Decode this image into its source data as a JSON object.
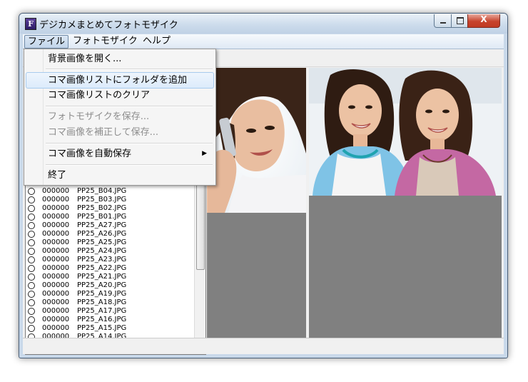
{
  "window": {
    "title": "デジカメまとめてフォトモザイク",
    "app_icon_letter": "F",
    "caption_buttons": {
      "min": "minimize",
      "max": "maximize",
      "close_glyph": "X"
    }
  },
  "menubar": [
    "ファイル",
    "フォトモザイク",
    "ヘルプ"
  ],
  "file_menu": {
    "open_background": "背景画像を開く...",
    "add_folder": "コマ画像リストにフォルダを追加",
    "clear_list": "コマ画像リストのクリア",
    "save_mosaic": "フォトモザイクを保存...",
    "correct_and_save": "コマ画像を補正して保存...",
    "auto_save": "コマ画像を自動保存",
    "exit": "終了"
  },
  "image_list": {
    "items": [
      {
        "num": "000000",
        "name": "PP25_B04.JPG"
      },
      {
        "num": "000000",
        "name": "PP25_B03.JPG"
      },
      {
        "num": "000000",
        "name": "PP25_B02.JPG"
      },
      {
        "num": "000000",
        "name": "PP25_B01.JPG"
      },
      {
        "num": "000000",
        "name": "PP25_A27.JPG"
      },
      {
        "num": "000000",
        "name": "PP25_A26.JPG"
      },
      {
        "num": "000000",
        "name": "PP25_A25.JPG"
      },
      {
        "num": "000000",
        "name": "PP25_A24.JPG"
      },
      {
        "num": "000000",
        "name": "PP25_A23.JPG"
      },
      {
        "num": "000000",
        "name": "PP25_A22.JPG"
      },
      {
        "num": "000000",
        "name": "PP25_A21.JPG"
      },
      {
        "num": "000000",
        "name": "PP25_A20.JPG"
      },
      {
        "num": "000000",
        "name": "PP25_A19.JPG"
      },
      {
        "num": "000000",
        "name": "PP25_A18.JPG"
      },
      {
        "num": "000000",
        "name": "PP25_A17.JPG"
      },
      {
        "num": "000000",
        "name": "PP25_A16.JPG"
      },
      {
        "num": "000000",
        "name": "PP25_A15.JPG"
      },
      {
        "num": "000000",
        "name": "PP25_A14.JPG"
      }
    ]
  },
  "colors": {
    "panel_gray": "#808080",
    "titlebar": "#cddcec",
    "menu_highlight": "#dcebfb",
    "close_button": "#c7432c"
  }
}
